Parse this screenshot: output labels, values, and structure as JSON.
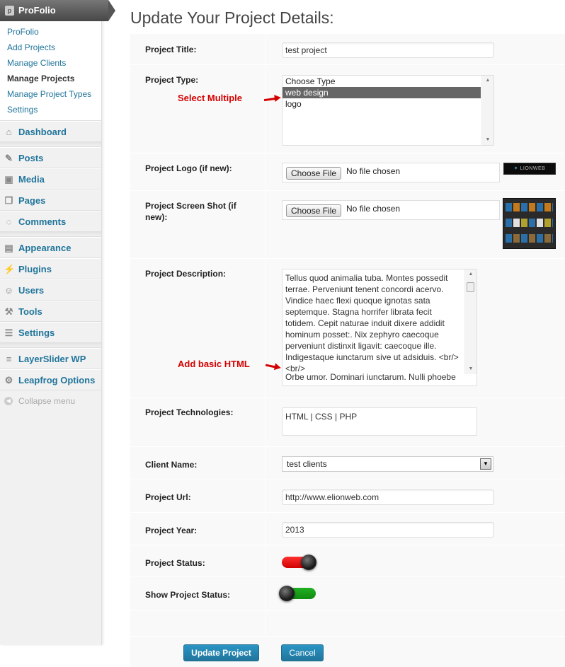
{
  "sidebar": {
    "plugin_title": "ProFolio",
    "submenu": [
      {
        "label": "ProFolio",
        "current": false
      },
      {
        "label": "Add Projects",
        "current": false
      },
      {
        "label": "Manage Clients",
        "current": false
      },
      {
        "label": "Manage Projects",
        "current": true
      },
      {
        "label": "Manage Project Types",
        "current": false
      },
      {
        "label": "Settings",
        "current": false
      }
    ],
    "dashboard": "Dashboard",
    "posts": "Posts",
    "media": "Media",
    "pages": "Pages",
    "comments": "Comments",
    "appearance": "Appearance",
    "plugins": "Plugins",
    "users": "Users",
    "tools": "Tools",
    "settings": "Settings",
    "layerslider": "LayerSlider WP",
    "leapfrog": "Leapfrog Options",
    "collapse": "Collapse menu"
  },
  "page": {
    "title": "Update Your Project Details:"
  },
  "form": {
    "title_label": "Project Title:",
    "title_value": "test project",
    "type_label": "Project Type:",
    "type_options": [
      "Choose Type",
      "web design",
      "logo"
    ],
    "type_selected": "web design",
    "annot_multiple": "Select Multiple",
    "logo_label": "Project Logo (if new):",
    "choose_file": "Choose File",
    "no_file": "No file chosen",
    "logo_thumb_text": "LIONWEB",
    "screenshot_label": "Project Screen Shot (if new):",
    "desc_label": "Project Description:",
    "desc_value": "Tellus quod animalia tuba. Montes possedit terrae. Perveniunt tenent concordi acervo. Vindice haec flexi quoque ignotas sata septemque. Stagna horrifer librata fecit totidem. Cepit naturae induit dixere addidit hominum posset:. Nix zephyro caecoque perveniunt distinxit ligavit: caecoque ille. Indigestaque iunctarum sive ut adsiduis. <br/><br/>",
    "desc_value_2": "Orbe umor. Dominari iunctarum. Nulli phoebe",
    "annot_html": "Add basic HTML",
    "tech_label": "Project Technologies:",
    "tech_value": "HTML | CSS | PHP",
    "client_label": "Client Name:",
    "client_value": "test clients",
    "url_label": "Project Url:",
    "url_value": "http://www.elionweb.com",
    "year_label": "Project Year:",
    "year_value": "2013",
    "status_label": "Project Status:",
    "show_status_label": "Show Project Status:",
    "update_button": "Update Project",
    "cancel_button": "Cancel"
  },
  "colors": {
    "accent": "#21759b",
    "annotation": "#d40000",
    "toggle_off": "#e00000",
    "toggle_on": "#1a9a1a"
  }
}
